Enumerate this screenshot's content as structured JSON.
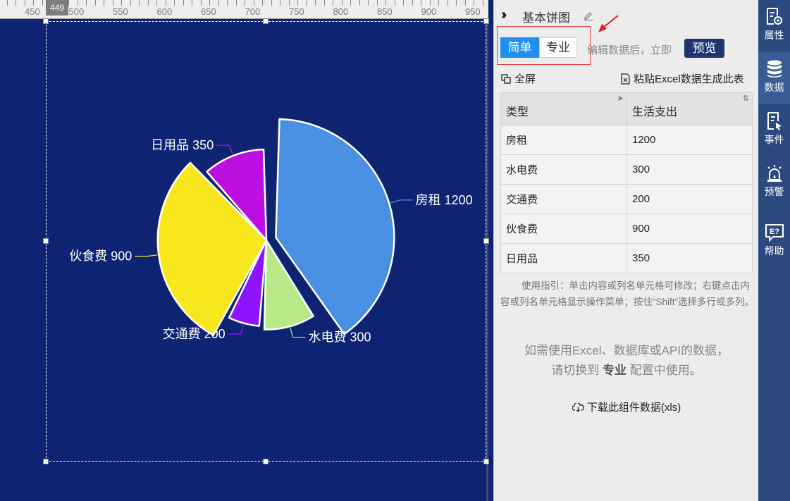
{
  "ruler": {
    "marker": "449",
    "labels": [
      "450",
      "500",
      "550",
      "600",
      "650",
      "700",
      "750",
      "800",
      "850",
      "900",
      "950"
    ]
  },
  "panel": {
    "title": "基本饼图",
    "mode_simple": "简单",
    "mode_pro": "专业",
    "edit_hint": "编辑数据后，立即",
    "preview_label": "预览",
    "fullscreen_label": "全屏",
    "paste_excel_label": "粘贴Excel数据生成此表",
    "table": {
      "headers": [
        "类型",
        "生活支出"
      ],
      "rows": [
        [
          "房租",
          "1200"
        ],
        [
          "水电费",
          "300"
        ],
        [
          "交通费",
          "200"
        ],
        [
          "伙食费",
          "900"
        ],
        [
          "日用品",
          "350"
        ]
      ]
    },
    "guide_text": "使用指引：单击内容或列名单元格可修改；右键点击内容或列名单元格显示操作菜单；按住“Shift”选择多行或多列。",
    "excel_note_line1": "如需使用Excel、数据库或API的数据，",
    "excel_note_line2_pre": "请切换到",
    "excel_note_line2_bold": "专业",
    "excel_note_line2_post": "配置中使用。",
    "download_label": "下载此组件数据(xls)"
  },
  "sidebar": {
    "items": [
      {
        "label": "属性",
        "icon": "properties-icon"
      },
      {
        "label": "数据",
        "icon": "database-icon"
      },
      {
        "label": "事件",
        "icon": "event-icon"
      },
      {
        "label": "预警",
        "icon": "alarm-icon"
      },
      {
        "label": "帮助",
        "icon": "help-icon"
      }
    ]
  },
  "colors": {
    "canvas_bg": "#0e2472",
    "accent": "#1f8ff0",
    "preview_btn": "#1e3570",
    "sidebar": "#2c4a80"
  },
  "chart_data": {
    "type": "pie",
    "series_name": "生活支出",
    "categories": [
      "房租",
      "水电费",
      "交通费",
      "伙食费",
      "日用品"
    ],
    "values": [
      1200,
      300,
      200,
      900,
      350
    ],
    "colors": [
      "#4a90e2",
      "#b8e986",
      "#9013fe",
      "#f8e71c",
      "#bd10e0"
    ],
    "labels": [
      "房租 1200",
      "水电费 300",
      "交通费 200",
      "伙食费 900",
      "日用品 350"
    ],
    "style": "rose-radius",
    "highlighted_slice": "房租"
  }
}
